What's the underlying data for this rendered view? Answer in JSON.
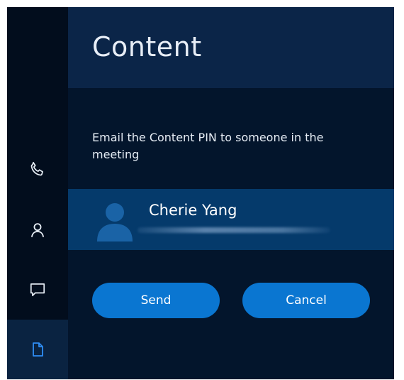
{
  "panel": {
    "title": "Content",
    "instruction": "Email the Content PIN to someone in the meeting"
  },
  "nav": {
    "items": [
      {
        "name": "calls",
        "icon": "phone-icon",
        "active": false
      },
      {
        "name": "contacts",
        "icon": "person-icon",
        "active": false
      },
      {
        "name": "chat",
        "icon": "chat-icon",
        "active": false
      },
      {
        "name": "content",
        "icon": "document-icon",
        "active": true
      }
    ]
  },
  "contact": {
    "name": "Cherie Yang",
    "avatar_icon": "person-avatar-icon",
    "detail_blurred": true
  },
  "buttons": {
    "send": "Send",
    "cancel": "Cancel"
  },
  "colors": {
    "accent": "#0a76d1",
    "selected_row": "#053a6b",
    "active_nav_icon": "#2f8ef5"
  }
}
